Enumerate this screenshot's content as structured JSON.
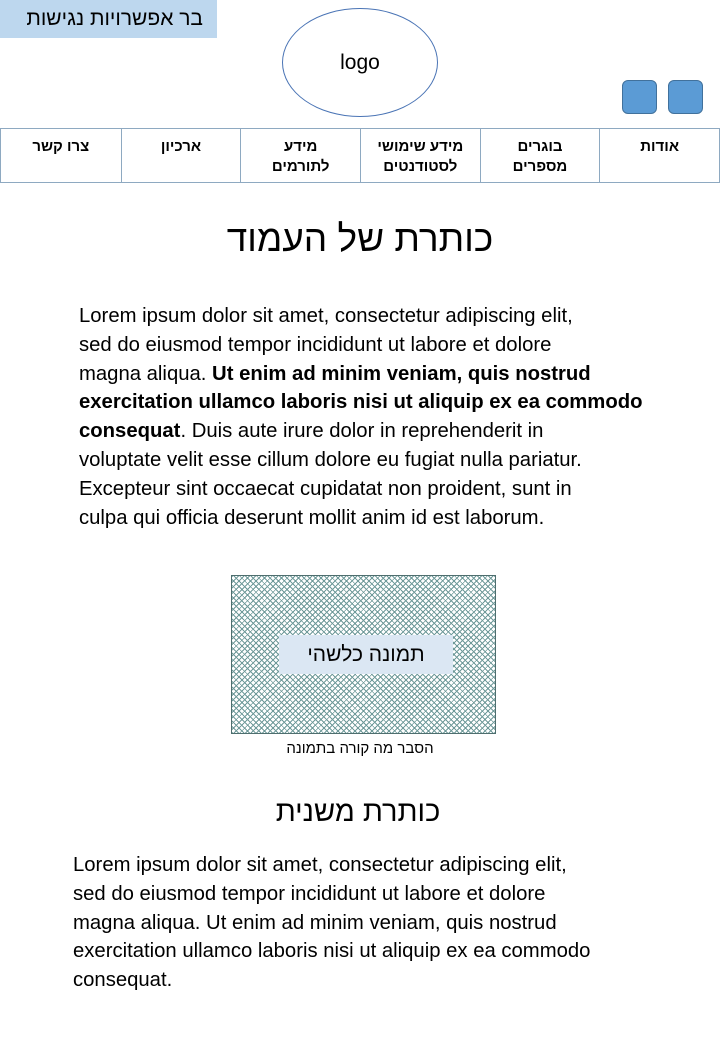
{
  "accessibility_bar": {
    "label": "בר אפשרויות נגישות"
  },
  "logo": {
    "label": "logo"
  },
  "header_buttons": [
    {
      "icon": "square-button"
    },
    {
      "icon": "square-button"
    }
  ],
  "nav": {
    "items": [
      {
        "line1": "אודות",
        "line2": ""
      },
      {
        "line1": "בוגרים",
        "line2": "מספרים"
      },
      {
        "line1": "מידע שימושי",
        "line2": "לסטודנטים"
      },
      {
        "line1": "מידע",
        "line2": "לתורמים"
      },
      {
        "line1": "ארכיון",
        "line2": ""
      },
      {
        "line1": "צרו קשר",
        "line2": ""
      }
    ]
  },
  "main": {
    "title": "כותרת של העמוד",
    "paragraph1": {
      "l1": "Lorem ipsum dolor sit amet, consectetur adipiscing elit,",
      "l2": "sed do eiusmod tempor incididunt ut labore et dolore",
      "l3_plain": "magna aliqua. ",
      "l3_bold": "Ut enim ad minim veniam, quis nostrud",
      "l4_bold": "exercitation ullamco laboris nisi ut aliquip ex ea commodo",
      "l5_bold": "consequat",
      "l5_plain": ". Duis aute irure dolor in reprehenderit in",
      "l6": "voluptate velit esse cillum dolore eu fugiat nulla pariatur.",
      "l7": "Excepteur sint occaecat cupidatat non proident, sunt in",
      "l8": "culpa qui officia deserunt mollit anim id est laborum."
    },
    "image": {
      "label": "תמונה כלשהי",
      "caption": "הסבר מה קורה בתמונה"
    },
    "subtitle": "כותרת משנית",
    "paragraph2": {
      "l1": "Lorem ipsum dolor sit amet, consectetur adipiscing elit,",
      "l2": "sed do eiusmod tempor incididunt ut labore et dolore",
      "l3": "magna aliqua. Ut enim ad minim veniam, quis nostrud",
      "l4": "exercitation ullamco laboris nisi ut aliquip ex ea commodo",
      "l5": "consequat."
    }
  },
  "colors": {
    "accessibility_bar_bg": "#bdd7ee",
    "button_fill": "#5b9bd5",
    "logo_border": "#4a74b5",
    "image_label_bg": "#dbe7f3"
  }
}
